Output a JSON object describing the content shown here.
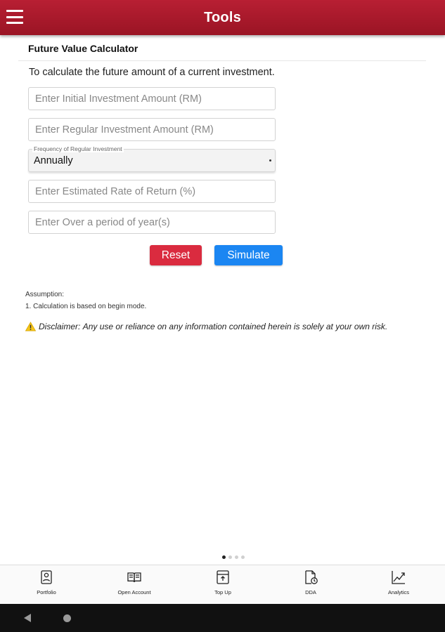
{
  "appbar": {
    "title": "Tools",
    "menu_icon": "hamburger-menu-icon"
  },
  "calculator": {
    "title": "Future Value Calculator",
    "intro": "To calculate the future amount of a current investment.",
    "fields": {
      "initial_placeholder": "Enter Initial Investment Amount (RM)",
      "regular_placeholder": "Enter Regular Investment Amount (RM)",
      "rate_placeholder": "Enter Estimated Rate of Return (%)",
      "period_placeholder": "Enter Over a period of year(s)"
    },
    "frequency": {
      "label": "Frequency of Regular Investment",
      "value": "Annually"
    },
    "buttons": {
      "reset": "Reset",
      "simulate": "Simulate"
    }
  },
  "assumption": {
    "title": "Assumption:",
    "items": [
      "1. Calculation is based on begin mode."
    ]
  },
  "disclaimer": {
    "label": "Disclaimer:",
    "text": "Any use or reliance on any information contained herein is solely at your own risk.",
    "icon": "warning-icon"
  },
  "pager": {
    "count": 4,
    "active": 0
  },
  "bottom_nav": {
    "items": [
      {
        "label": "Portfolio",
        "icon": "portfolio-icon"
      },
      {
        "label": "Open Account",
        "icon": "open-account-icon"
      },
      {
        "label": "Top Up",
        "icon": "top-up-icon"
      },
      {
        "label": "DDA",
        "icon": "dda-icon"
      },
      {
        "label": "Analytics",
        "icon": "analytics-icon"
      }
    ]
  },
  "colors": {
    "brand": "#b81f33",
    "reset": "#da2b3f",
    "simulate": "#1b86f2",
    "warning": "#f5c518"
  }
}
